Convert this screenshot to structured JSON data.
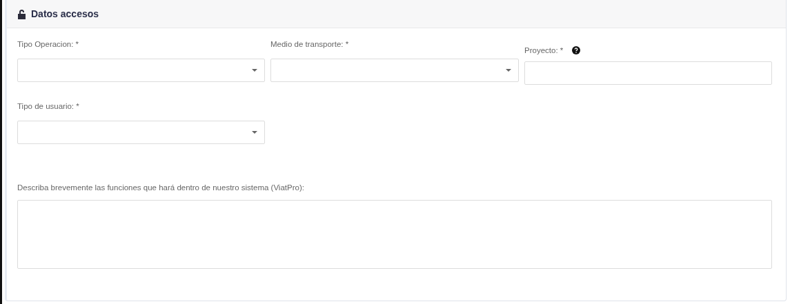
{
  "panel": {
    "title": "Datos accesos"
  },
  "fields": [
    {
      "kind": "select",
      "label": "Tipo Operacion: *"
    },
    {
      "kind": "select",
      "label": "Medio de transporte: *"
    },
    {
      "kind": "text",
      "label": "Proyecto: *",
      "help": true
    },
    {
      "kind": "select",
      "label": "Tipo de usuario: *"
    }
  ],
  "description": {
    "label": "Describa brevemente las funciones que hará dentro de nuestro sistema (ViatPro):"
  }
}
